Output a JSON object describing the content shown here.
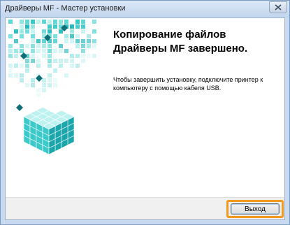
{
  "window": {
    "title": "Драйверы MF - Мастер установки"
  },
  "titlebar": {
    "close_icon": "close-icon"
  },
  "content": {
    "heading": "Копирование файлов Драйверы MF завершено.",
    "message": "Чтобы завершить установку, подключите принтер к компьютеру с помощью кабеля USB."
  },
  "footer": {
    "exit_label": "Выход"
  },
  "colors": {
    "accent_cyan": "#2ec8c8",
    "highlight_orange": "#f29a1e",
    "title_blue": "#c9daf0"
  }
}
